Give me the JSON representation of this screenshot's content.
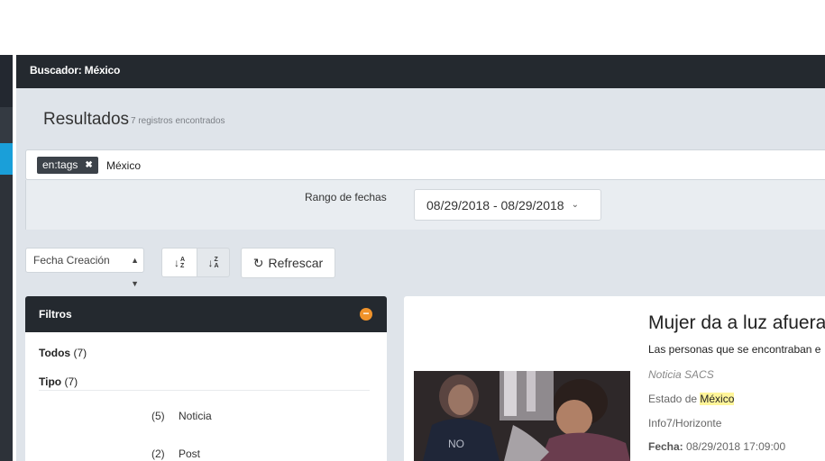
{
  "header": {
    "title": "Buscador: México"
  },
  "results": {
    "title": "Resultados",
    "count": "7 registros encontrados"
  },
  "search": {
    "tag_label": "en:tags",
    "tag_remove": "✖",
    "query": "México"
  },
  "date_filter": {
    "label": "Rango de fechas",
    "range": "08/29/2018 - 08/29/2018"
  },
  "toolbar": {
    "sort_field": "Fecha Creación",
    "sort_asc_top": "A",
    "sort_asc_bottom": "Z",
    "sort_desc_top": "Z",
    "sort_desc_bottom": "A",
    "refresh_label": "Refrescar"
  },
  "filters": {
    "title": "Filtros",
    "collapse_symbol": "−",
    "todos_label": "Todos",
    "todos_count": "(7)",
    "tipo_label": "Tipo",
    "tipo_count": "(7)",
    "items": [
      {
        "count": "(5)",
        "label": "Noticia"
      },
      {
        "count": "(2)",
        "label": "Post"
      }
    ]
  },
  "result": {
    "title": "Mujer da a luz afuera",
    "summary": "Las personas que se encontraban e",
    "source": "Noticia SACS",
    "state_prefix": "Estado de ",
    "state_highlight": "México",
    "outlet": "Info7/Horizonte",
    "date_label": "Fecha:",
    "date_value": "08/29/2018 17:09:00"
  },
  "colors": {
    "accent": "#1a9fd9",
    "dark_bar": "#24292f",
    "collapse": "#f0932b",
    "highlight": "#fff59a"
  }
}
